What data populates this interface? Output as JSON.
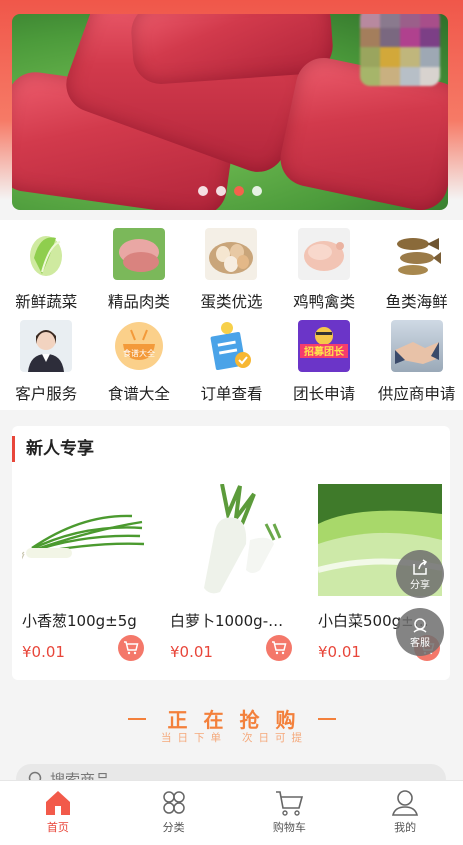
{
  "banner": {
    "image": "fresh-meat-banner",
    "slide_count": 4,
    "active_slide": 3
  },
  "categories": [
    {
      "label": "新鲜蔬菜",
      "icon": "cabbage-icon"
    },
    {
      "label": "精品肉类",
      "icon": "meat-icon"
    },
    {
      "label": "蛋类优选",
      "icon": "eggs-icon"
    },
    {
      "label": "鸡鸭禽类",
      "icon": "chicken-icon"
    },
    {
      "label": "鱼类海鲜",
      "icon": "fish-icon"
    },
    {
      "label": "客户服务",
      "icon": "customer-service-icon"
    },
    {
      "label": "食谱大全",
      "icon": "recipe-icon",
      "badge": "食谱大全"
    },
    {
      "label": "订单查看",
      "icon": "order-icon"
    },
    {
      "label": "团长申请",
      "icon": "leader-recruit-icon",
      "badge": "招募团长"
    },
    {
      "label": "供应商申请",
      "icon": "supplier-icon"
    }
  ],
  "newcomer": {
    "title": "新人专享",
    "products": [
      {
        "name": "小香葱100g±5g",
        "price": "¥0.01",
        "image": "scallion"
      },
      {
        "name": "白萝卜1000g-…",
        "price": "¥0.01",
        "image": "white-radish"
      },
      {
        "name": "小白菜500g±…",
        "price": "¥0.01",
        "image": "bok-choy"
      }
    ]
  },
  "float_buttons": {
    "share": "分享",
    "service": "客服"
  },
  "flash_sale": {
    "title": "正在抢购",
    "sub_left": "当日下单",
    "sub_right": "次日可提"
  },
  "search": {
    "placeholder": "搜索商品"
  },
  "tabbar": [
    {
      "label": "首页",
      "icon": "home-icon",
      "active": true
    },
    {
      "label": "分类",
      "icon": "category-icon",
      "active": false
    },
    {
      "label": "购物车",
      "icon": "cart-icon",
      "active": false
    },
    {
      "label": "我的",
      "icon": "user-icon",
      "active": false
    }
  ],
  "colors": {
    "accent": "#e8463a",
    "flash": "#f3803b"
  }
}
